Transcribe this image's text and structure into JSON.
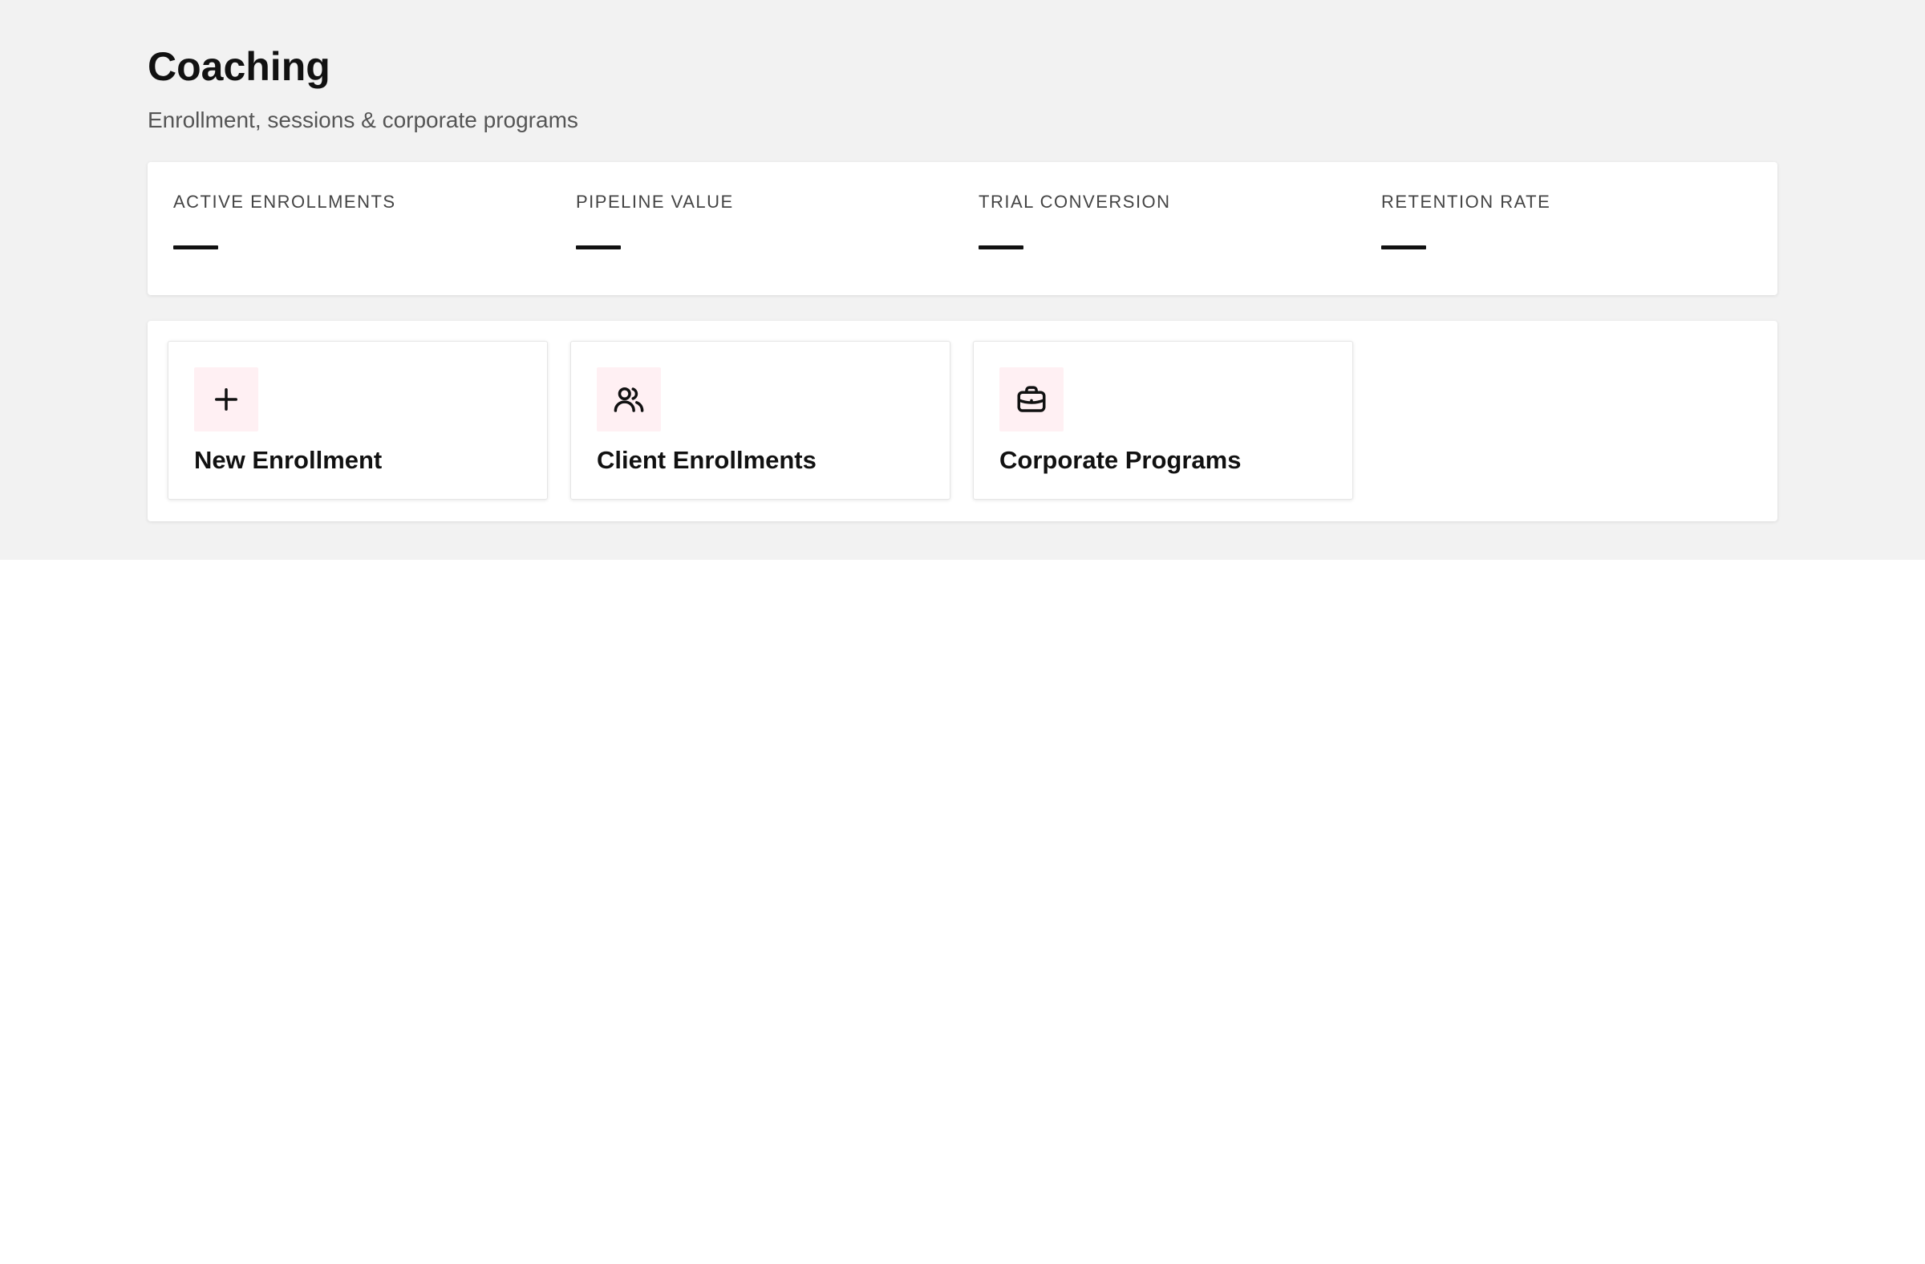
{
  "header": {
    "title": "Coaching",
    "subtitle": "Enrollment, sessions & corporate programs"
  },
  "stats": [
    {
      "label": "ACTIVE ENROLLMENTS",
      "value": "—"
    },
    {
      "label": "PIPELINE VALUE",
      "value": "—"
    },
    {
      "label": "TRIAL CONVERSION",
      "value": "—"
    },
    {
      "label": "RETENTION RATE",
      "value": "—"
    }
  ],
  "actions": [
    {
      "label": "New Enrollment",
      "icon": "plus-icon"
    },
    {
      "label": "Client Enrollments",
      "icon": "users-icon"
    },
    {
      "label": "Corporate Programs",
      "icon": "briefcase-icon"
    }
  ],
  "colors": {
    "page_background": "#f2f2f2",
    "icon_tile_background": "#fff0f3",
    "text": "#111111",
    "muted_text": "#555555"
  }
}
